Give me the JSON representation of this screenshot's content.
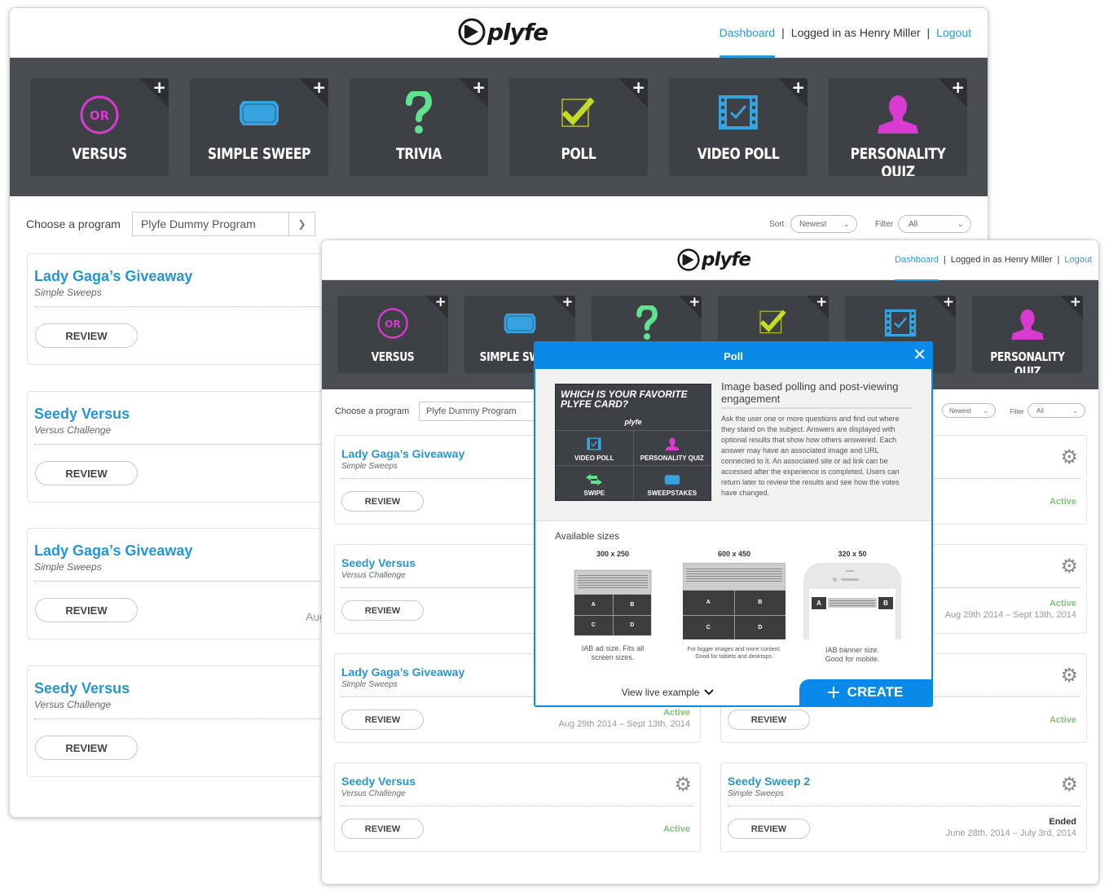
{
  "brand": {
    "name": "plyfe"
  },
  "nav": {
    "dashboard": "Dashboard",
    "separator": "|",
    "logged_in": "Logged in as Henry Miller",
    "logout": "Logout"
  },
  "tiles": [
    {
      "label": "VERSUS",
      "icon": "or-circle-icon",
      "color": "#d93ad0"
    },
    {
      "label": "SIMPLE SWEEP",
      "icon": "ticket-icon",
      "color": "#36a3de"
    },
    {
      "label": "TRIVIA",
      "icon": "question-mark-icon",
      "color": "#5ee38f"
    },
    {
      "label": "POLL",
      "icon": "checkbox-icon",
      "color": "#c5dc26"
    },
    {
      "label": "VIDEO POLL",
      "icon": "film-check-icon",
      "color": "#36a3de"
    },
    {
      "label": "PERSONALITY QUIZ",
      "icon": "person-icon",
      "color": "#d93ad0"
    }
  ],
  "tile_add": "+",
  "toolbar": {
    "choose_label": "Choose a program",
    "program": "Plyfe Dummy Program",
    "sort_label": "Sort",
    "sort_value": "Newest",
    "filter_label": "Filter",
    "filter_value": "All"
  },
  "back_cards": [
    {
      "title": "Lady Gaga’s Giveaway",
      "type": "Simple Sweeps",
      "button": "REVIEW"
    },
    {
      "title": "Seedy Versus",
      "type": "Versus Challenge",
      "button": "REVIEW"
    },
    {
      "title": "Lady Gaga’s Giveaway",
      "type": "Simple Sweeps",
      "button": "REVIEW",
      "date_partial": "Aug"
    },
    {
      "title": "Seedy Versus",
      "type": "Versus Challenge",
      "button": "REVIEW"
    }
  ],
  "front_cards": [
    {
      "title": "Lady Gaga’s Giveaway",
      "type": "Simple Sweeps",
      "button": "REVIEW"
    },
    {
      "title": "",
      "type": "",
      "button": "",
      "status": "Active"
    },
    {
      "title": "Seedy Versus",
      "type": "Versus Challenge",
      "button": "REVIEW"
    },
    {
      "title": "",
      "type": "",
      "button": "",
      "status": "Active",
      "dates": "Aug 29th 2014 – Sept 13th, 2014"
    },
    {
      "title": "Lady Gaga’s Giveaway",
      "type": "Simple Sweeps",
      "button": "REVIEW",
      "status": "Active",
      "dates": "Aug 29th 2014 – Sept 13th, 2014"
    },
    {
      "title": "",
      "type": "",
      "button": "REVIEW",
      "status": "Active"
    },
    {
      "title": "Seedy Versus",
      "type": "Versus Challenge",
      "button": "REVIEW",
      "status": "Active"
    },
    {
      "title": "Seedy Sweep 2",
      "type": "Simple Sweeps",
      "button": "REVIEW",
      "status": "Ended",
      "dates": "June 28th, 2014 – July 3rd, 2014"
    }
  ],
  "status_colors": {
    "Active": "#7cc576",
    "Ended": "#333333"
  },
  "modal": {
    "title": "Poll",
    "close": "✕",
    "preview": {
      "question": "WHICH IS YOUR FAVORITE PLYFE CARD?",
      "brand": "plyfe",
      "options": [
        {
          "label": "VIDEO POLL",
          "icon": "film-check-icon"
        },
        {
          "label": "PERSONALITY QUIZ",
          "icon": "person-icon"
        },
        {
          "label": "SWIPE",
          "icon": "swap-arrows-icon"
        },
        {
          "label": "SWEEPSTAKES",
          "icon": "ticket-icon"
        }
      ]
    },
    "heading": "Image based polling and post-viewing engagement",
    "description": "Ask the user one or more questions and find out where they stand on the subject. Answers are displayed with optional results that show how others answered. Each answer may have an associated image and URL connected to it. An associated site or ad link can be accessed after the experience is completed. Users can return later to review the results and see how the votes have changed.",
    "sizes_label": "Available sizes",
    "sizes": [
      {
        "label": "300 x 250",
        "note": "IAB ad size. Fits all screen sizes.",
        "cells": [
          "A",
          "B",
          "C",
          "D"
        ]
      },
      {
        "label": "600 x 450",
        "note": "For bigger images and more content. Good for tablets and desktops.",
        "cells": [
          "A",
          "B",
          "C",
          "D"
        ]
      },
      {
        "label": "320 x 50",
        "note": "IAB banner size. Good for mobile.",
        "cells": [
          "A",
          "B"
        ]
      }
    ],
    "view_live": "View live example",
    "create": "CREATE"
  }
}
